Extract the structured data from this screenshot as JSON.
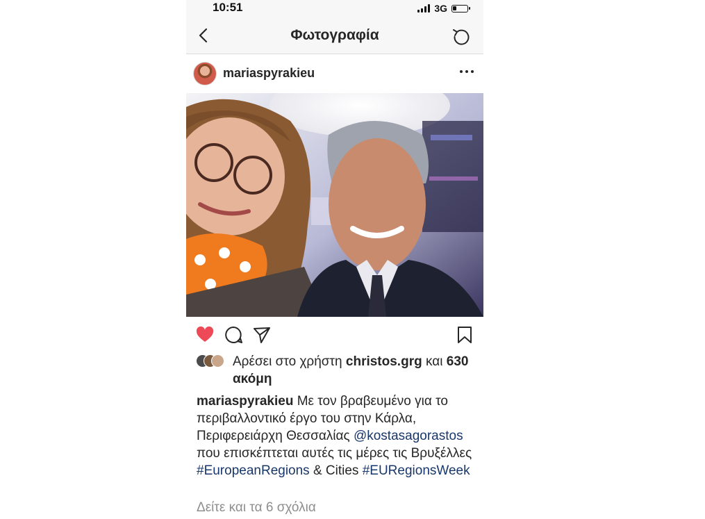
{
  "status_bar": {
    "time": "10:51",
    "network": "3G",
    "battery_level": 0.2
  },
  "nav": {
    "title": "Φωτογραφία",
    "back_icon": "chevron-left-icon",
    "refresh_icon": "refresh-icon"
  },
  "post": {
    "username": "mariaspyrakieu",
    "more_icon": "ellipsis-icon",
    "image": "selfie-photo",
    "actions": {
      "liked": true,
      "like_color": "#ed4956"
    },
    "likes": {
      "prefix": "Αρέσει στο χρήστη",
      "user": "christos.grg",
      "connector": "και",
      "count": "630 ακόμη"
    },
    "caption": {
      "username": "mariaspyrakieu",
      "text1": "Με τον βραβευμένο για το περιβαλλοντικό έργο του στην Κάρλα, Περιφερειάρχη Θεσσαλίας",
      "mention": "@kostasagorastos",
      "text2": "που επισκέπτεται αυτές τις μέρες τις Βρυξέλλες",
      "hashtag1": "#EuropeanRegions",
      "text3": "& Cities",
      "hashtag2": "#EURegionsWeek"
    },
    "view_comments": "Δείτε και τα 6 σχόλια"
  },
  "colors": {
    "link": "#18376b",
    "like_red": "#ed4956",
    "muted": "#8e8e8e"
  }
}
